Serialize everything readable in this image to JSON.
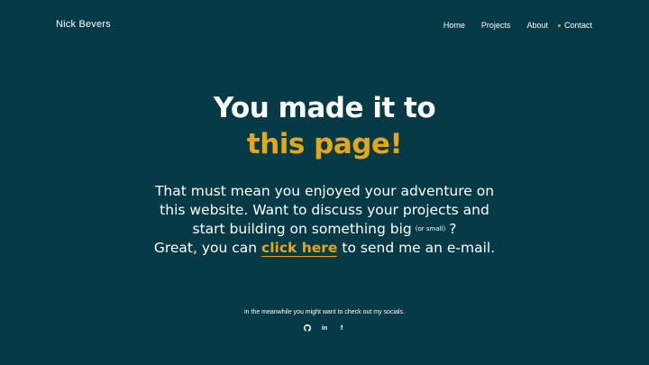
{
  "header": {
    "brand": "Nick Bevers",
    "nav": [
      {
        "label": "Home"
      },
      {
        "label": "Projects"
      },
      {
        "label": "About"
      },
      {
        "label": "Contact"
      }
    ],
    "active_item": "Contact"
  },
  "hero": {
    "title_line1": "You made it to",
    "title_line2": "this page!"
  },
  "body": {
    "line1": "That must mean you enjoyed your adventure on",
    "line2": "this website. Want to discuss your projects and",
    "line3_start": "start building on something big",
    "line3_small": "(or small)",
    "line3_end": "?",
    "line4_start": "Great, you can",
    "cta_link": "click here",
    "line4_end": "to send me an e-mail."
  },
  "socials": {
    "text": "in the meanwhile you might want to check out my socials.",
    "icons": [
      {
        "name": "github-icon"
      },
      {
        "name": "linkedin-icon",
        "glyph": "in"
      },
      {
        "name": "facebook-icon",
        "glyph": "f"
      }
    ]
  },
  "colors": {
    "background": "#063a47",
    "accent": "#e6a619",
    "text": "#ffffff"
  }
}
